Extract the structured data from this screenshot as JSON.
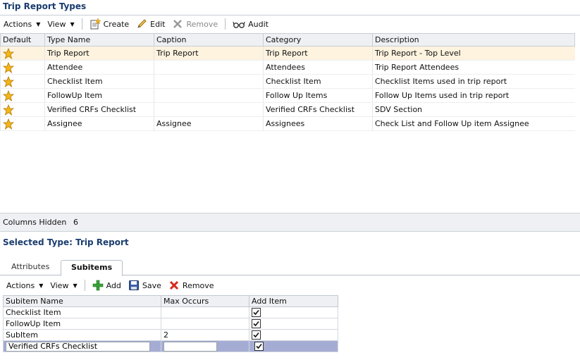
{
  "page_title": "Trip Report Types",
  "toolbar1": {
    "actions": "Actions",
    "view": "View",
    "create": "Create",
    "edit": "Edit",
    "remove": "Remove",
    "audit": "Audit"
  },
  "grid1": {
    "headers": [
      "Default",
      "Type Name",
      "Caption",
      "Category",
      "Description"
    ],
    "rows": [
      {
        "type_name": "Trip Report",
        "caption": "Trip Report",
        "category": "Trip Report",
        "description": "Trip Report - Top Level"
      },
      {
        "type_name": "Attendee",
        "caption": "",
        "category": "Attendees",
        "description": "Trip Report Attendees"
      },
      {
        "type_name": "Checklist Item",
        "caption": "",
        "category": "Checklist Item",
        "description": "Checklist Items used in trip report"
      },
      {
        "type_name": "FollowUp Item",
        "caption": "",
        "category": "Follow Up Items",
        "description": "Follow Up Items used in trip report"
      },
      {
        "type_name": "Verified CRFs Checklist",
        "caption": "",
        "category": "Verified CRFs Checklist",
        "description": "SDV Section"
      },
      {
        "type_name": "Assignee",
        "caption": "Assignee",
        "category": "Assignees",
        "description": "Check List and Follow Up item Assignee"
      }
    ]
  },
  "status_bar": {
    "label": "Columns Hidden",
    "count": "6"
  },
  "selected_title": "Selected Type: Trip Report",
  "tabs": [
    "Attributes",
    "Subitems"
  ],
  "toolbar2": {
    "actions": "Actions",
    "view": "View",
    "add": "Add",
    "save": "Save",
    "remove": "Remove"
  },
  "grid2": {
    "headers": [
      "Subitem Name",
      "Max Occurs",
      "Add Item"
    ],
    "rows": [
      {
        "name": "Checklist Item",
        "max": "",
        "checked": true
      },
      {
        "name": "FollowUp Item",
        "max": "",
        "checked": true
      },
      {
        "name": "SubItem",
        "max": "2",
        "checked": true
      },
      {
        "name": "Verified CRFs Checklist",
        "max": "",
        "checked": true
      }
    ]
  },
  "colors": {
    "title": "#1a3d6e",
    "selected_row": "#fdf3df",
    "edit_row": "#a5acd4",
    "star": "#f2b61b"
  }
}
